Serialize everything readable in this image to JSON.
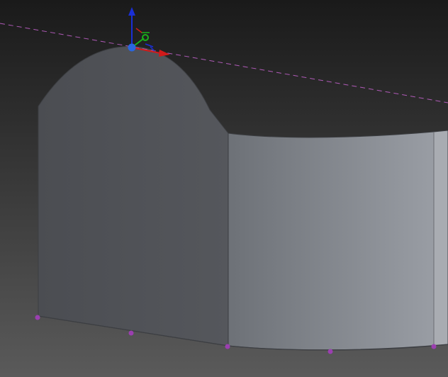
{
  "viewport": {
    "background_top": "#1a1a1a",
    "background_bottom": "#5a5a5a"
  },
  "colors": {
    "face_dark": "#55575c",
    "face_dark_edge": "#4b4d52",
    "face_light_left": "#6d7177",
    "face_light_right": "#999da4",
    "face_far": "#a9acb2",
    "edge_line": "#3c3e42",
    "reference_line": "#b05ab8",
    "vertex_marker": "#9b3fb0",
    "gizmo_x": "#d11a1a",
    "gizmo_y": "#19b019",
    "gizmo_z": "#1a2fd6",
    "gizmo_origin": "#2a66e0"
  },
  "icons": {
    "transform_gizmo": "move-gizmo-icon",
    "pivot_point": "pivot-point-icon",
    "vertex_marker": "vertex-marker-icon"
  }
}
